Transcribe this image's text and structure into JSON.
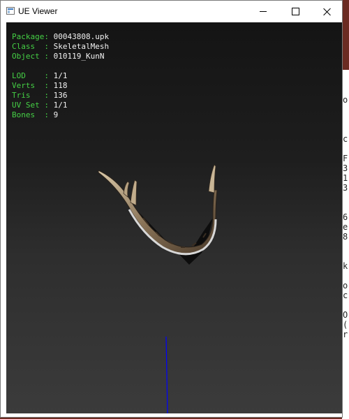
{
  "window": {
    "title": "UE Viewer"
  },
  "info": {
    "header_rows": [
      {
        "key": "Package: ",
        "value": "00043808.upk"
      },
      {
        "key": "Class  : ",
        "value": "SkeletalMesh"
      },
      {
        "key": "Object : ",
        "value": "010119_KunN"
      }
    ],
    "stats_rows": [
      {
        "key": "LOD    : ",
        "value": "1/1"
      },
      {
        "key": "Verts  : ",
        "value": "118"
      },
      {
        "key": "Tris   : ",
        "value": "136"
      },
      {
        "key": "UV Set : ",
        "value": "1/1"
      },
      {
        "key": "Bones  : ",
        "value": "9"
      }
    ]
  },
  "background_window": {
    "lines": [
      "o",
      "c",
      "F",
      "3",
      "1",
      "3",
      "6",
      "e",
      "8",
      "k",
      "o",
      "c",
      "O",
      "(",
      "r"
    ]
  },
  "colors": {
    "key_text": "#45d045",
    "value_text": "#f2f2f2",
    "axis": "#0000ff"
  }
}
